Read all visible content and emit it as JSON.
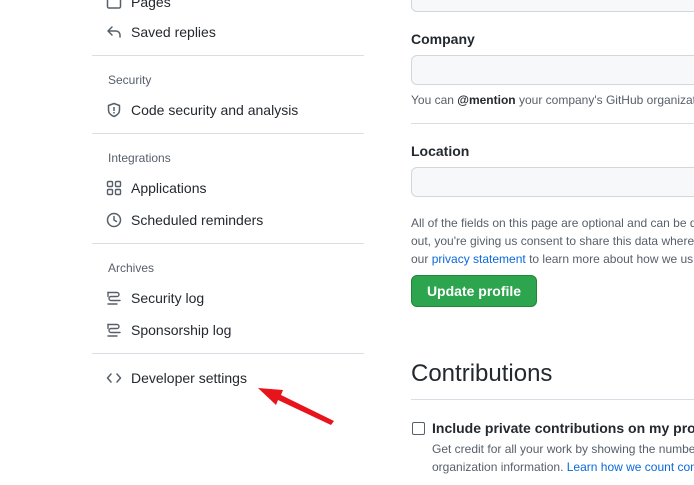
{
  "sidebar": {
    "saved_replies": "Saved replies",
    "pages_partial": "Pages",
    "security_title": "Security",
    "code_security": "Code security and analysis",
    "integrations_title": "Integrations",
    "applications": "Applications",
    "scheduled_reminders": "Scheduled reminders",
    "archives_title": "Archives",
    "security_log": "Security log",
    "sponsorship_log": "Sponsorship log",
    "developer_settings": "Developer settings"
  },
  "form": {
    "company_label": "Company",
    "company_value": "",
    "company_note_prefix": "You can ",
    "company_note_mention": "@mention",
    "company_note_suffix": " your company's GitHub organizati",
    "location_label": "Location",
    "location_value": "",
    "disclaimer_line1": "All of the fields on this page are optional and can be d",
    "disclaimer_line2": "out, you're giving us consent to share this data where",
    "disclaimer_line3_prefix": "our ",
    "disclaimer_link": "privacy statement",
    "disclaimer_line3_suffix": " to learn more about how we us",
    "update_button": "Update profile"
  },
  "contributions": {
    "heading": "Contributions",
    "checkbox_label": "Include private contributions on my profil",
    "checkbox_checked": false,
    "desc_line1": "Get credit for all your work by showing the numbe",
    "desc_line2_prefix": "organization information. ",
    "desc_link": "Learn how we count con"
  },
  "colors": {
    "accent_green": "#2da44e",
    "link_blue": "#0969da",
    "annotation_arrow": "#e8141b"
  }
}
